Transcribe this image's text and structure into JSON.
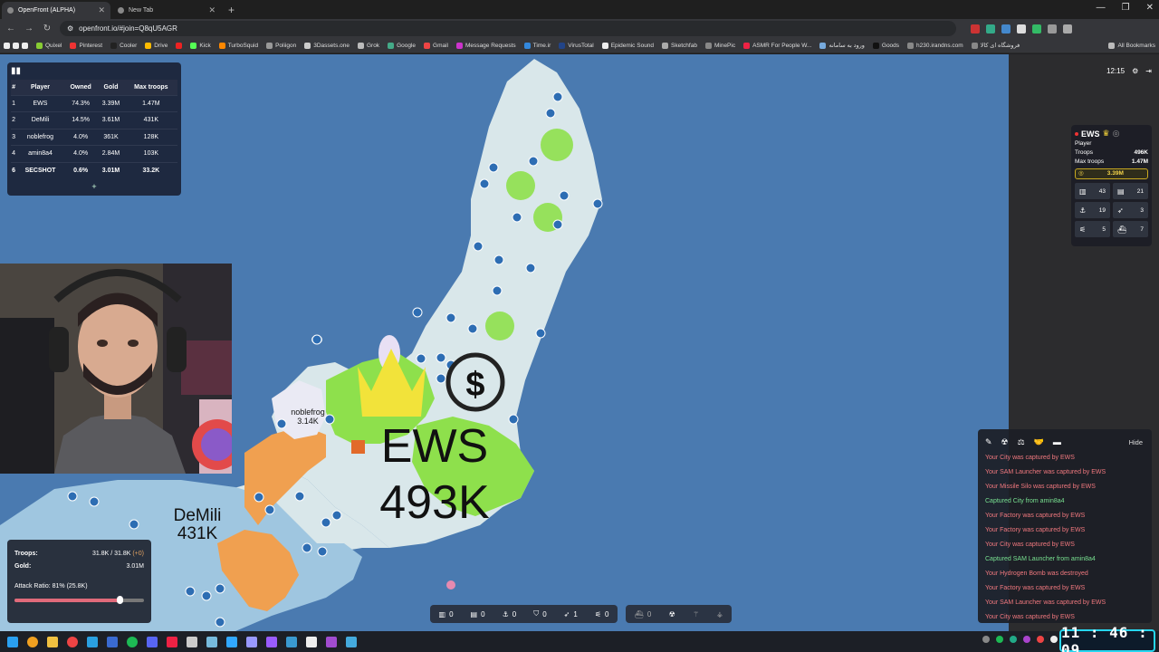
{
  "browser": {
    "tabs": [
      {
        "label": "OpenFront (ALPHA)",
        "active": true
      },
      {
        "label": "New Tab",
        "active": false
      }
    ],
    "url": "openfront.io/#join=Q8qU5AGR",
    "bookmarks": [
      "Quixel",
      "Pinterest",
      "Cooler",
      "Drive",
      "Kick",
      "TurboSquid",
      "Poliigon",
      "3Dassets.one",
      "Grok",
      "Google",
      "Gmail",
      "Message Requests",
      "Time.ir",
      "VirusTotal",
      "Epidemic Sound",
      "Sketchfab",
      "MinePic",
      "ASMR For People W...",
      "ورود به سامانه",
      "Goods",
      "h230.irandns.com",
      "فروشگاه ای کالا"
    ],
    "all_bookmarks": "All Bookmarks"
  },
  "leaderboard": {
    "headers": [
      "#",
      "Player",
      "Owned",
      "Gold",
      "Max troops"
    ],
    "rows": [
      {
        "rank": "1",
        "player": "EWS",
        "owned": "74.3%",
        "gold": "3.39M",
        "max": "1.47M"
      },
      {
        "rank": "2",
        "player": "DeMili",
        "owned": "14.5%",
        "gold": "3.61M",
        "max": "431K"
      },
      {
        "rank": "3",
        "player": "noblefrog",
        "owned": "4.0%",
        "gold": "361K",
        "max": "128K"
      },
      {
        "rank": "4",
        "player": "amin8a4",
        "owned": "4.0%",
        "gold": "2.84M",
        "max": "103K"
      },
      {
        "rank": "6",
        "player": "SECSHOT",
        "owned": "0.6%",
        "gold": "3.01M",
        "max": "33.2K"
      }
    ],
    "expand": "+"
  },
  "map": {
    "labels": {
      "ews_name": "EWS",
      "ews_troops": "493K",
      "demili_name": "DeMili",
      "demili_troops": "431K",
      "noblefrog_name": "noblefrog",
      "noblefrog_troops": "3.14K"
    }
  },
  "clock": "12:15",
  "player_info": {
    "name": "EWS",
    "type": "Player",
    "troops_label": "Troops",
    "troops": "496K",
    "max_label": "Max troops",
    "max": "1.47M",
    "gold": "3.39M",
    "stats": [
      {
        "icon": "city-icon",
        "value": "43"
      },
      {
        "icon": "factory-icon",
        "value": "21"
      },
      {
        "icon": "port-icon",
        "value": "19"
      },
      {
        "icon": "missile-silo-icon",
        "value": "3"
      },
      {
        "icon": "sam-launcher-icon",
        "value": "5"
      },
      {
        "icon": "warship-icon",
        "value": "7"
      }
    ]
  },
  "troops_panel": {
    "troops_label": "Troops:",
    "troops_value": "31.8K / 31.8K",
    "troops_delta": "(+0)",
    "gold_label": "Gold:",
    "gold_value": "3.01M",
    "attack_label": "Attack Ratio: 81% (25.8K)",
    "attack_ratio": 0.81
  },
  "events": {
    "hide": "Hide",
    "messages": [
      {
        "text": "Your City was captured by EWS",
        "kind": "red"
      },
      {
        "text": "Your SAM Launcher was captured by EWS",
        "kind": "red"
      },
      {
        "text": "Your Missile Silo was captured by EWS",
        "kind": "red"
      },
      {
        "text": "Captured City from amin8a4",
        "kind": "green"
      },
      {
        "text": "Your Factory was captured by EWS",
        "kind": "red"
      },
      {
        "text": "Your Factory was captured by EWS",
        "kind": "red"
      },
      {
        "text": "Your City was captured by EWS",
        "kind": "red"
      },
      {
        "text": "Captured SAM Launcher from amin8a4",
        "kind": "green"
      },
      {
        "text": "Your Hydrogen Bomb was destroyed",
        "kind": "red"
      },
      {
        "text": "Your Factory was captured by EWS",
        "kind": "red"
      },
      {
        "text": "Your SAM Launcher was captured by EWS",
        "kind": "red"
      },
      {
        "text": "Your City was captured by EWS",
        "kind": "red"
      }
    ]
  },
  "buildbar": {
    "items": [
      {
        "icon": "city-icon",
        "count": "0"
      },
      {
        "icon": "factory-icon",
        "count": "0"
      },
      {
        "icon": "port-icon",
        "count": "0"
      },
      {
        "icon": "defense-post-icon",
        "count": "0"
      },
      {
        "icon": "missile-silo-icon",
        "count": "1"
      },
      {
        "icon": "sam-launcher-icon",
        "count": "0"
      }
    ],
    "items2": [
      {
        "icon": "warship-icon",
        "count": "0"
      },
      {
        "icon": "atom-bomb-icon",
        "count": ""
      },
      {
        "icon": "hydrogen-bomb-icon",
        "count": ""
      },
      {
        "icon": "mirv-icon",
        "count": ""
      }
    ]
  },
  "taskbar_clock": "11 : 46 : 09",
  "colors": {
    "ocean": "#4a7ab0",
    "land": "#d9e7ea",
    "ews": "#8ee04c",
    "demili": "#9fc6e0",
    "orange": "#f0a050"
  }
}
